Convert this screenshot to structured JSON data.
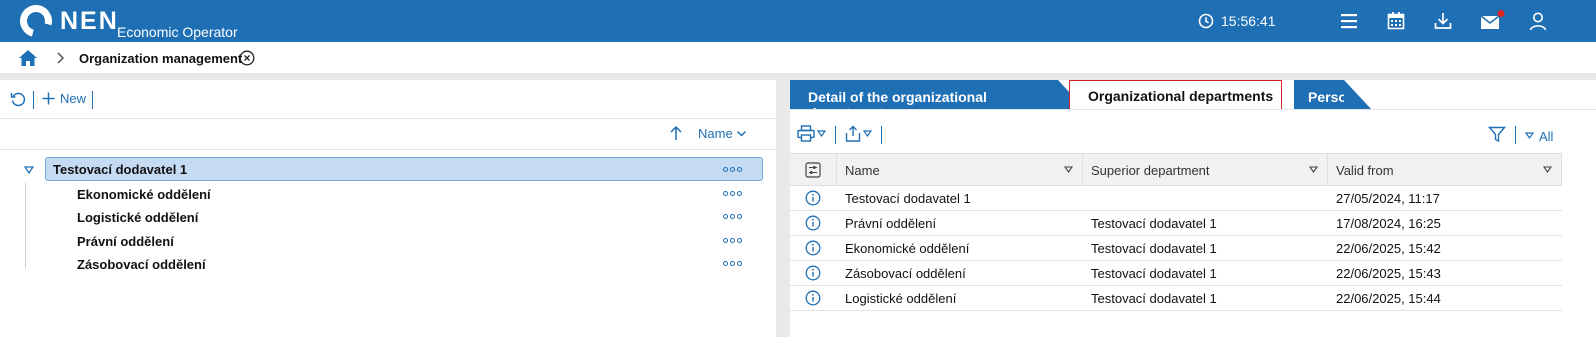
{
  "header": {
    "brand": "NEN",
    "subtitle": "Economic Operator",
    "clock": "15:56:41",
    "icons": [
      "menu-icon",
      "calendar-icon",
      "download-icon",
      "mail-icon",
      "user-icon"
    ],
    "accent": "#1f6fb5",
    "notification_color": "#e02424"
  },
  "breadcrumb": {
    "current": "Organization management"
  },
  "left_panel": {
    "new_label": "New",
    "sort_label": "Name",
    "tree": {
      "root": "Testovací dodavatel 1",
      "children": [
        "Ekonomické oddělení",
        "Logistické oddělení",
        "Právní oddělení",
        "Zásobovací oddělení"
      ]
    }
  },
  "right_panel": {
    "tabs": [
      {
        "label": "Detail of the organizational department",
        "active": false
      },
      {
        "label": "Organizational departments",
        "active": true
      },
      {
        "label": "Persons",
        "active": false
      }
    ],
    "filter_all_label": "All",
    "table": {
      "columns": [
        "Name",
        "Superior department",
        "Valid from"
      ],
      "rows": [
        {
          "name": "Testovací dodavatel 1",
          "superior": "",
          "valid_from": "27/05/2024, 11:17"
        },
        {
          "name": "Právní oddělení",
          "superior": "Testovací dodavatel 1",
          "valid_from": "17/08/2024, 16:25"
        },
        {
          "name": "Ekonomické oddělení",
          "superior": "Testovací dodavatel 1",
          "valid_from": "22/06/2025, 15:42"
        },
        {
          "name": "Zásobovací oddělení",
          "superior": "Testovací dodavatel 1",
          "valid_from": "22/06/2025, 15:43"
        },
        {
          "name": "Logistické oddělení",
          "superior": "Testovací dodavatel 1",
          "valid_from": "22/06/2025, 15:44"
        }
      ]
    }
  }
}
